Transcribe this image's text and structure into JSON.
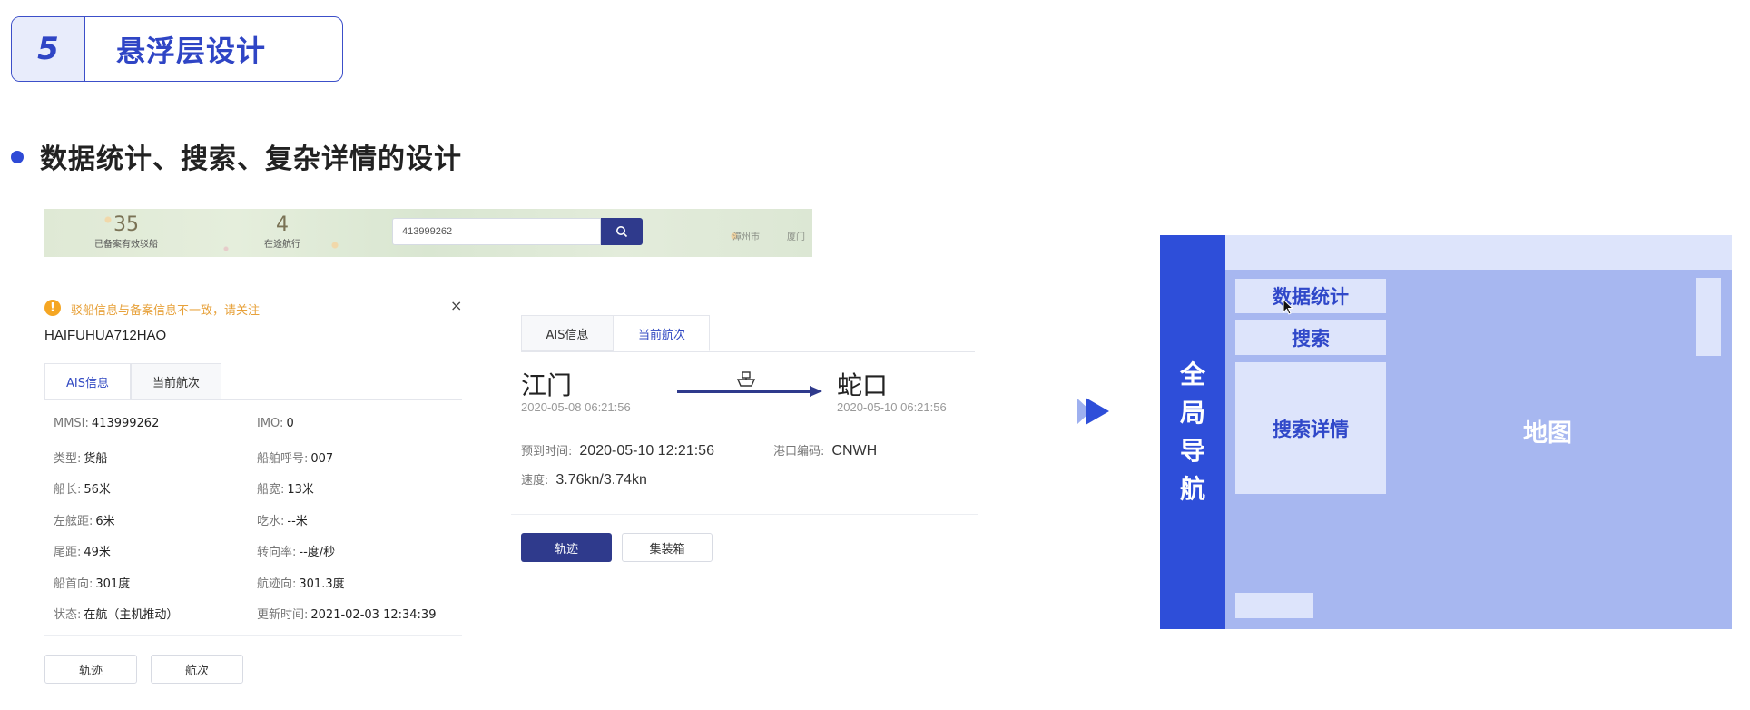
{
  "section": {
    "number": "5",
    "title": "悬浮层设计"
  },
  "bullet": "数据统计、搜索、复杂详情的设计",
  "map_strip": {
    "stats": [
      {
        "value": "35",
        "label": "已备案有效驳船"
      },
      {
        "value": "4",
        "label": "在途航行"
      }
    ],
    "search_value": "413999262",
    "town_labels": [
      "漳州市",
      "厦门"
    ]
  },
  "detail_panel": {
    "warning": "驳船信息与备案信息不一致，请关注",
    "close": "×",
    "ship_name": "HAIFUHUA712HAO",
    "tabs": [
      "AIS信息",
      "当前航次"
    ],
    "fields": [
      {
        "label": "MMSI:",
        "value": "413999262"
      },
      {
        "label": "IMO:",
        "value": "0"
      },
      {
        "label": "类型:",
        "value": "货船"
      },
      {
        "label": "船舶呼号:",
        "value": "007"
      },
      {
        "label": "船长:",
        "value": "56米"
      },
      {
        "label": "船宽:",
        "value": "13米"
      },
      {
        "label": "左舷距:",
        "value": "6米"
      },
      {
        "label": "吃水:",
        "value": "--米"
      },
      {
        "label": "尾距:",
        "value": "49米"
      },
      {
        "label": "转向率:",
        "value": "--度/秒"
      },
      {
        "label": "船首向:",
        "value": "301度"
      },
      {
        "label": "航迹向:",
        "value": "301.3度"
      },
      {
        "label": "状态:",
        "value": "在航（主机推动）"
      },
      {
        "label": "更新时间:",
        "value": "2021-02-03 12:34:39"
      }
    ],
    "buttons": [
      "轨迹",
      "航次"
    ]
  },
  "voyage_panel": {
    "tabs": [
      "AIS信息",
      "当前航次"
    ],
    "from_port": "江门",
    "from_time": "2020-05-08  06:21:56",
    "to_port": "蛇口",
    "to_time": "2020-05-10  06:21:56",
    "eta_label": "预到时间:",
    "eta_value": "2020-05-10  12:21:56",
    "port_code_label": "港口编码:",
    "port_code_value": "CNWH",
    "speed_label": "速度:",
    "speed_value": "3.76kn/3.74kn",
    "buttons": [
      "轨迹",
      "集装箱"
    ]
  },
  "wireframe": {
    "nav_chars": [
      "全",
      "局",
      "导",
      "航"
    ],
    "box_stats": "数据统计",
    "box_search": "搜索",
    "box_detail": "搜索详情",
    "map_label": "地图"
  },
  "colors": {
    "accent": "#2f45c5",
    "dark_button": "#2f3a8c",
    "warning": "#f5a623",
    "wire_nav": "#2e4ed9",
    "wire_bg": "#a7b7f0",
    "wire_box": "#dde4fb"
  }
}
